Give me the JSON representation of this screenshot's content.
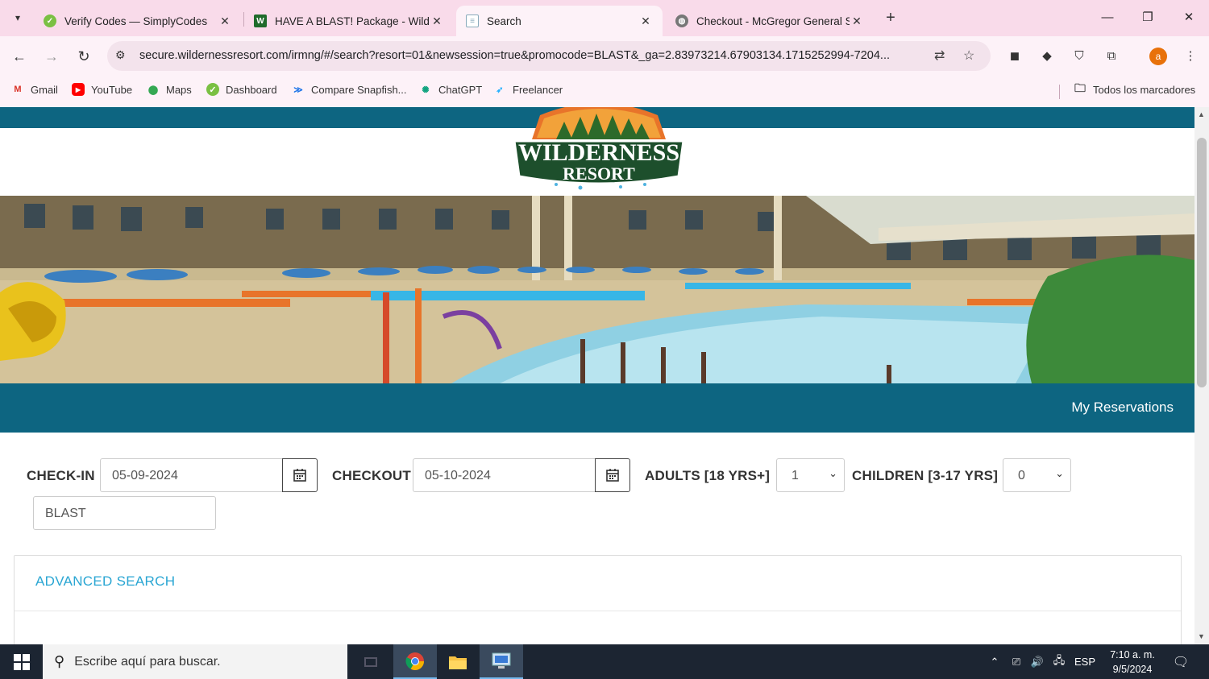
{
  "browser": {
    "tabs": [
      {
        "title": "Verify Codes — SimplyCodes",
        "icon": "simplycodes-icon",
        "active": false
      },
      {
        "title": "HAVE A BLAST! Package - Wilde",
        "icon": "wilderness-w-icon",
        "active": false
      },
      {
        "title": "Search",
        "icon": "page-icon",
        "active": true
      },
      {
        "title": "Checkout - McGregor General S",
        "icon": "globe-icon",
        "active": false
      }
    ],
    "url": "secure.wildernessresort.com/irmng/#/search?resort=01&newsession=true&promocode=BLAST&_ga=2.83973214.67903134.1715252994-7204...",
    "profile_initial": "a",
    "bookmarks": [
      {
        "label": "Gmail",
        "icon": "gmail-icon"
      },
      {
        "label": "YouTube",
        "icon": "youtube-icon"
      },
      {
        "label": "Maps",
        "icon": "maps-icon"
      },
      {
        "label": "Dashboard",
        "icon": "dashboard-icon"
      },
      {
        "label": "Compare Snapfish...",
        "icon": "snapfish-icon"
      },
      {
        "label": "ChatGPT",
        "icon": "chatgpt-icon"
      },
      {
        "label": "Freelancer",
        "icon": "freelancer-icon"
      }
    ],
    "all_bookmarks": "Todos los marcadores"
  },
  "site": {
    "logo_line1": "WILDERNESS",
    "logo_line2": "RESORT",
    "my_reservations": "My Reservations",
    "colors": {
      "teal": "#0d6581",
      "link": "#2aa6d3"
    }
  },
  "search": {
    "checkin_label": "CHECK-IN",
    "checkin_value": "05-09-2024",
    "checkout_label": "CHECKOUT",
    "checkout_value": "05-10-2024",
    "adults_label": "ADULTS [18 YRS+]",
    "adults_value": "1",
    "children_label": "CHILDREN [3-17 YRS]",
    "children_value": "0",
    "promo_value": "BLAST",
    "advanced_search": "ADVANCED SEARCH"
  },
  "taskbar": {
    "search_placeholder": "Escribe aquí para buscar.",
    "language": "ESP",
    "time": "7:10 a. m.",
    "date": "9/5/2024"
  }
}
